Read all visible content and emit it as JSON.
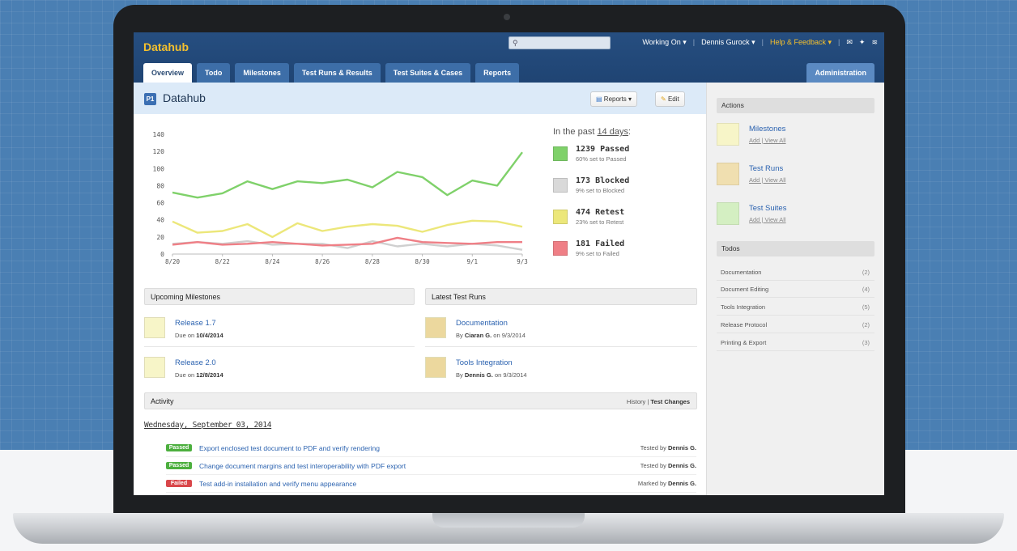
{
  "header": {
    "app_name": "Datahub",
    "search_icon": "search-icon",
    "working_on": "Working On ▾",
    "user": "Dennis Gurock ▾",
    "help": "Help & Feedback ▾",
    "icons": [
      "mail-icon",
      "twitter-icon",
      "rss-icon"
    ]
  },
  "tabs": [
    {
      "label": "Overview"
    },
    {
      "label": "Todo"
    },
    {
      "label": "Milestones"
    },
    {
      "label": "Test Runs & Results"
    },
    {
      "label": "Test Suites & Cases"
    },
    {
      "label": "Reports"
    }
  ],
  "admin_tab": "Administration",
  "project": {
    "badge": "P1",
    "title": "Datahub",
    "reports_button": "Reports ▾",
    "edit_button": "Edit"
  },
  "summary": {
    "prefix": "In the past ",
    "period": "14 days",
    "suffix": ":",
    "stats": [
      {
        "title": "1239 Passed",
        "sub": "60% set to Passed",
        "color": "#7fd16a"
      },
      {
        "title": "173 Blocked",
        "sub": "9% set to Blocked",
        "color": "#d9d9d9"
      },
      {
        "title": "474 Retest",
        "sub": "23% set to Retest",
        "color": "#ece77a"
      },
      {
        "title": "181 Failed",
        "sub": "9% set to Failed",
        "color": "#ef7f86"
      }
    ]
  },
  "chart_data": {
    "type": "line",
    "x_tick_labels": [
      "8/20",
      "8/22",
      "8/24",
      "8/26",
      "8/28",
      "8/30",
      "9/1",
      "9/3"
    ],
    "ylim": [
      0,
      140
    ],
    "y_ticks": [
      0,
      20,
      40,
      60,
      80,
      100,
      120,
      140
    ],
    "grid": false,
    "series": [
      {
        "color": "#7fd16a",
        "values": [
          72,
          66,
          71,
          85,
          76,
          85,
          83,
          87,
          78,
          96,
          90,
          69,
          86,
          80,
          119
        ]
      },
      {
        "color": "#ece77a",
        "values": [
          38,
          25,
          27,
          35,
          20,
          36,
          27,
          32,
          35,
          33,
          26,
          34,
          39,
          38,
          32
        ]
      },
      {
        "color": "#cfcfcf",
        "values": [
          12,
          14,
          12,
          15,
          11,
          12,
          12,
          7,
          15,
          9,
          12,
          9,
          12,
          10,
          5
        ]
      },
      {
        "color": "#ef7f86",
        "values": [
          11,
          14,
          11,
          12,
          14,
          12,
          10,
          11,
          12,
          19,
          14,
          13,
          12,
          14,
          14
        ]
      }
    ]
  },
  "milestones": {
    "header": "Upcoming Milestones",
    "items": [
      {
        "title": "Release 1.7",
        "sub_prefix": "Due on ",
        "sub_bold": "10/4/2014"
      },
      {
        "title": "Release 2.0",
        "sub_prefix": "Due on ",
        "sub_bold": "12/8/2014"
      }
    ]
  },
  "runs": {
    "header": "Latest Test Runs",
    "items": [
      {
        "title": "Documentation",
        "sub_prefix": "By ",
        "sub_bold": "Ciaran G.",
        "sub_suffix": " on 9/3/2014"
      },
      {
        "title": "Tools Integration",
        "sub_prefix": "By ",
        "sub_bold": "Dennis G.",
        "sub_suffix": " on 9/3/2014"
      }
    ]
  },
  "activity": {
    "header": "Activity",
    "history_link": "History",
    "sep": " | ",
    "changes_link": "Test Changes",
    "date": "Wednesday, September 03, 2014",
    "rows": [
      {
        "status": "Passed",
        "text": "Export enclosed test document to PDF and verify rendering",
        "meta_prefix": "Tested by ",
        "meta_bold": "Dennis G."
      },
      {
        "status": "Passed",
        "text": "Change document margins and test interoperability with PDF export",
        "meta_prefix": "Tested by ",
        "meta_bold": "Dennis G."
      },
      {
        "status": "Failed",
        "text": "Test add-in installation and verify menu appearance",
        "meta_prefix": "Marked by ",
        "meta_bold": "Dennis G."
      }
    ]
  },
  "sidebar": {
    "actions_header": "Actions",
    "actions": [
      {
        "title": "Milestones",
        "sub": "Add | View All",
        "color": "#f7f5c8"
      },
      {
        "title": "Test Runs",
        "sub": "Add | View All",
        "color": "#f0dfb0"
      },
      {
        "title": "Test Suites",
        "sub": "Add | View All",
        "color": "#d4efc2"
      }
    ],
    "todos_header": "Todos",
    "todos": [
      {
        "label": "Documentation",
        "count": "(2)"
      },
      {
        "label": "Document Editing",
        "count": "(4)"
      },
      {
        "label": "Tools Integration",
        "count": "(5)"
      },
      {
        "label": "Release Protocol",
        "count": "(2)"
      },
      {
        "label": "Printing & Export",
        "count": "(3)"
      }
    ]
  }
}
